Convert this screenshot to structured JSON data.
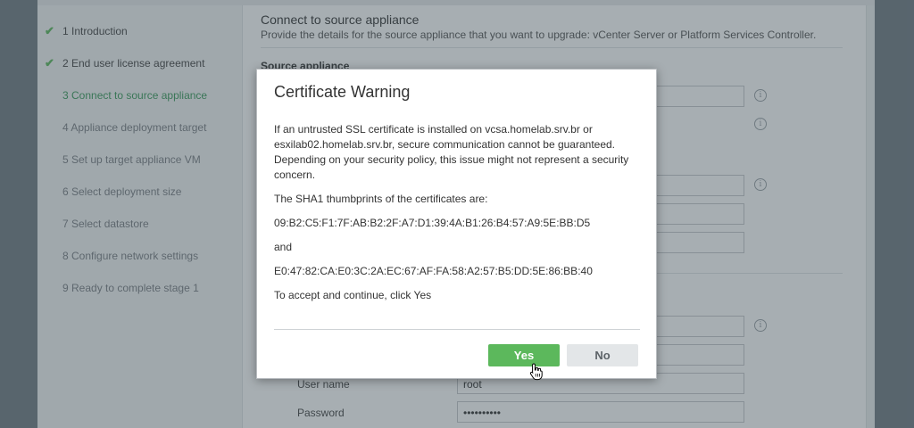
{
  "wizard": {
    "steps": [
      {
        "label": "1 Introduction",
        "done": true
      },
      {
        "label": "2 End user license agreement",
        "done": true
      },
      {
        "label": "3 Connect to source appliance",
        "current": true
      },
      {
        "label": "4 Appliance deployment target"
      },
      {
        "label": "5 Set up target appliance VM"
      },
      {
        "label": "6 Select deployment size"
      },
      {
        "label": "7 Select datastore"
      },
      {
        "label": "8 Configure network settings"
      },
      {
        "label": "9 Ready to complete stage 1"
      }
    ],
    "content": {
      "title": "Connect to source appliance",
      "subtitle": "Provide the details for the source appliance that you want to upgrade: vCenter Server or Platform Services Controller.",
      "section_source": "Source appliance",
      "user_name_label": "User name",
      "user_name_value": "root",
      "password_label": "Password",
      "password_value": "••••••••••"
    }
  },
  "dialog": {
    "title": "Certificate Warning",
    "paragraph1": "If an untrusted SSL certificate is installed on vcsa.homelab.srv.br or esxilab02.homelab.srv.br, secure communication cannot be guaranteed. Depending on your security policy, this issue might not represent a security concern.",
    "thumbprints_intro": "The SHA1 thumbprints of the certificates are:",
    "thumbprint1": "09:B2:C5:F1:7F:AB:B2:2F:A7:D1:39:4A:B1:26:B4:57:A9:5E:BB:D5",
    "and_text": "and",
    "thumbprint2": "E0:47:82:CA:E0:3C:2A:EC:67:AF:FA:58:A2:57:B5:DD:5E:86:BB:40",
    "accept_text": "To accept and continue, click Yes",
    "yes_label": "Yes",
    "no_label": "No"
  },
  "colors": {
    "accent_green": "#5cb85c",
    "overlay": "#3c4b55"
  }
}
